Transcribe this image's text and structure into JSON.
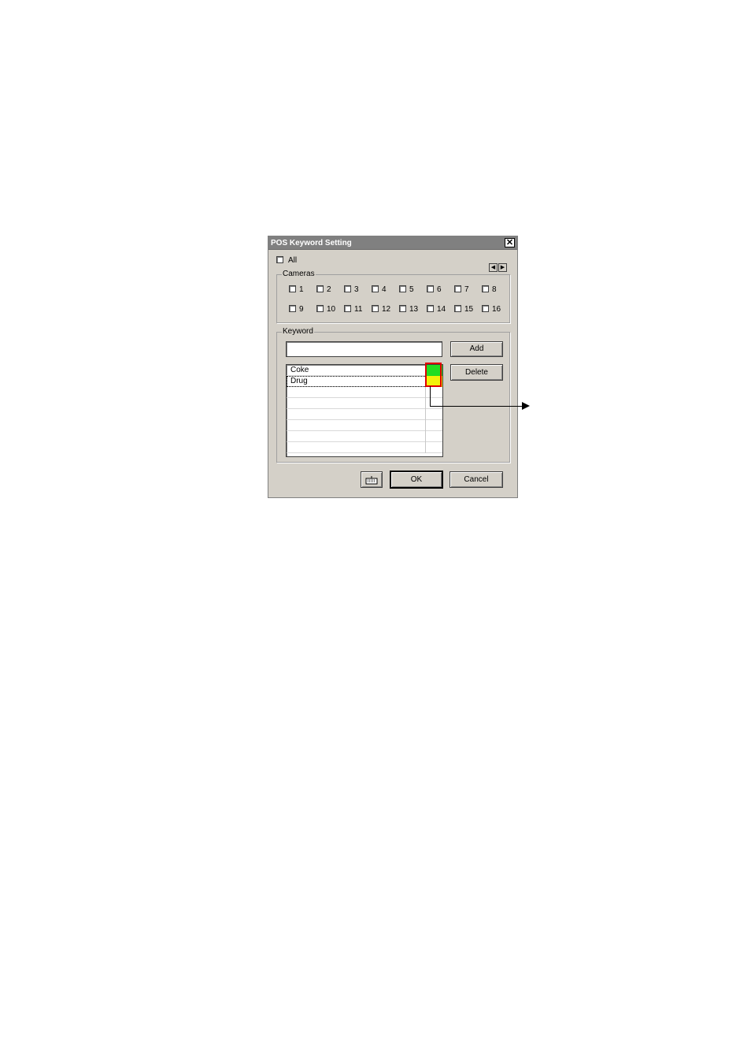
{
  "dialog": {
    "title": "POS Keyword Setting",
    "close_symbol": "✕",
    "all_label": "All",
    "cameras_group_label": "Cameras",
    "scroll_left": "◀",
    "scroll_right": "▶",
    "cameras": [
      "1",
      "2",
      "3",
      "4",
      "5",
      "6",
      "7",
      "8",
      "9",
      "10",
      "11",
      "12",
      "13",
      "14",
      "15",
      "16"
    ],
    "keyword_group_label": "Keyword",
    "keyword_input_value": "",
    "add_label": "Add",
    "delete_label": "Delete",
    "keywords": [
      {
        "text": "Coke",
        "color": "#22dd22"
      },
      {
        "text": "Drug",
        "color": "#f2f20a"
      }
    ],
    "ok_label": "OK",
    "cancel_label": "Cancel"
  },
  "colors": {
    "dialog_bg": "#d4d0c8",
    "titlebar": "#808080",
    "highlight": "#e00000"
  }
}
